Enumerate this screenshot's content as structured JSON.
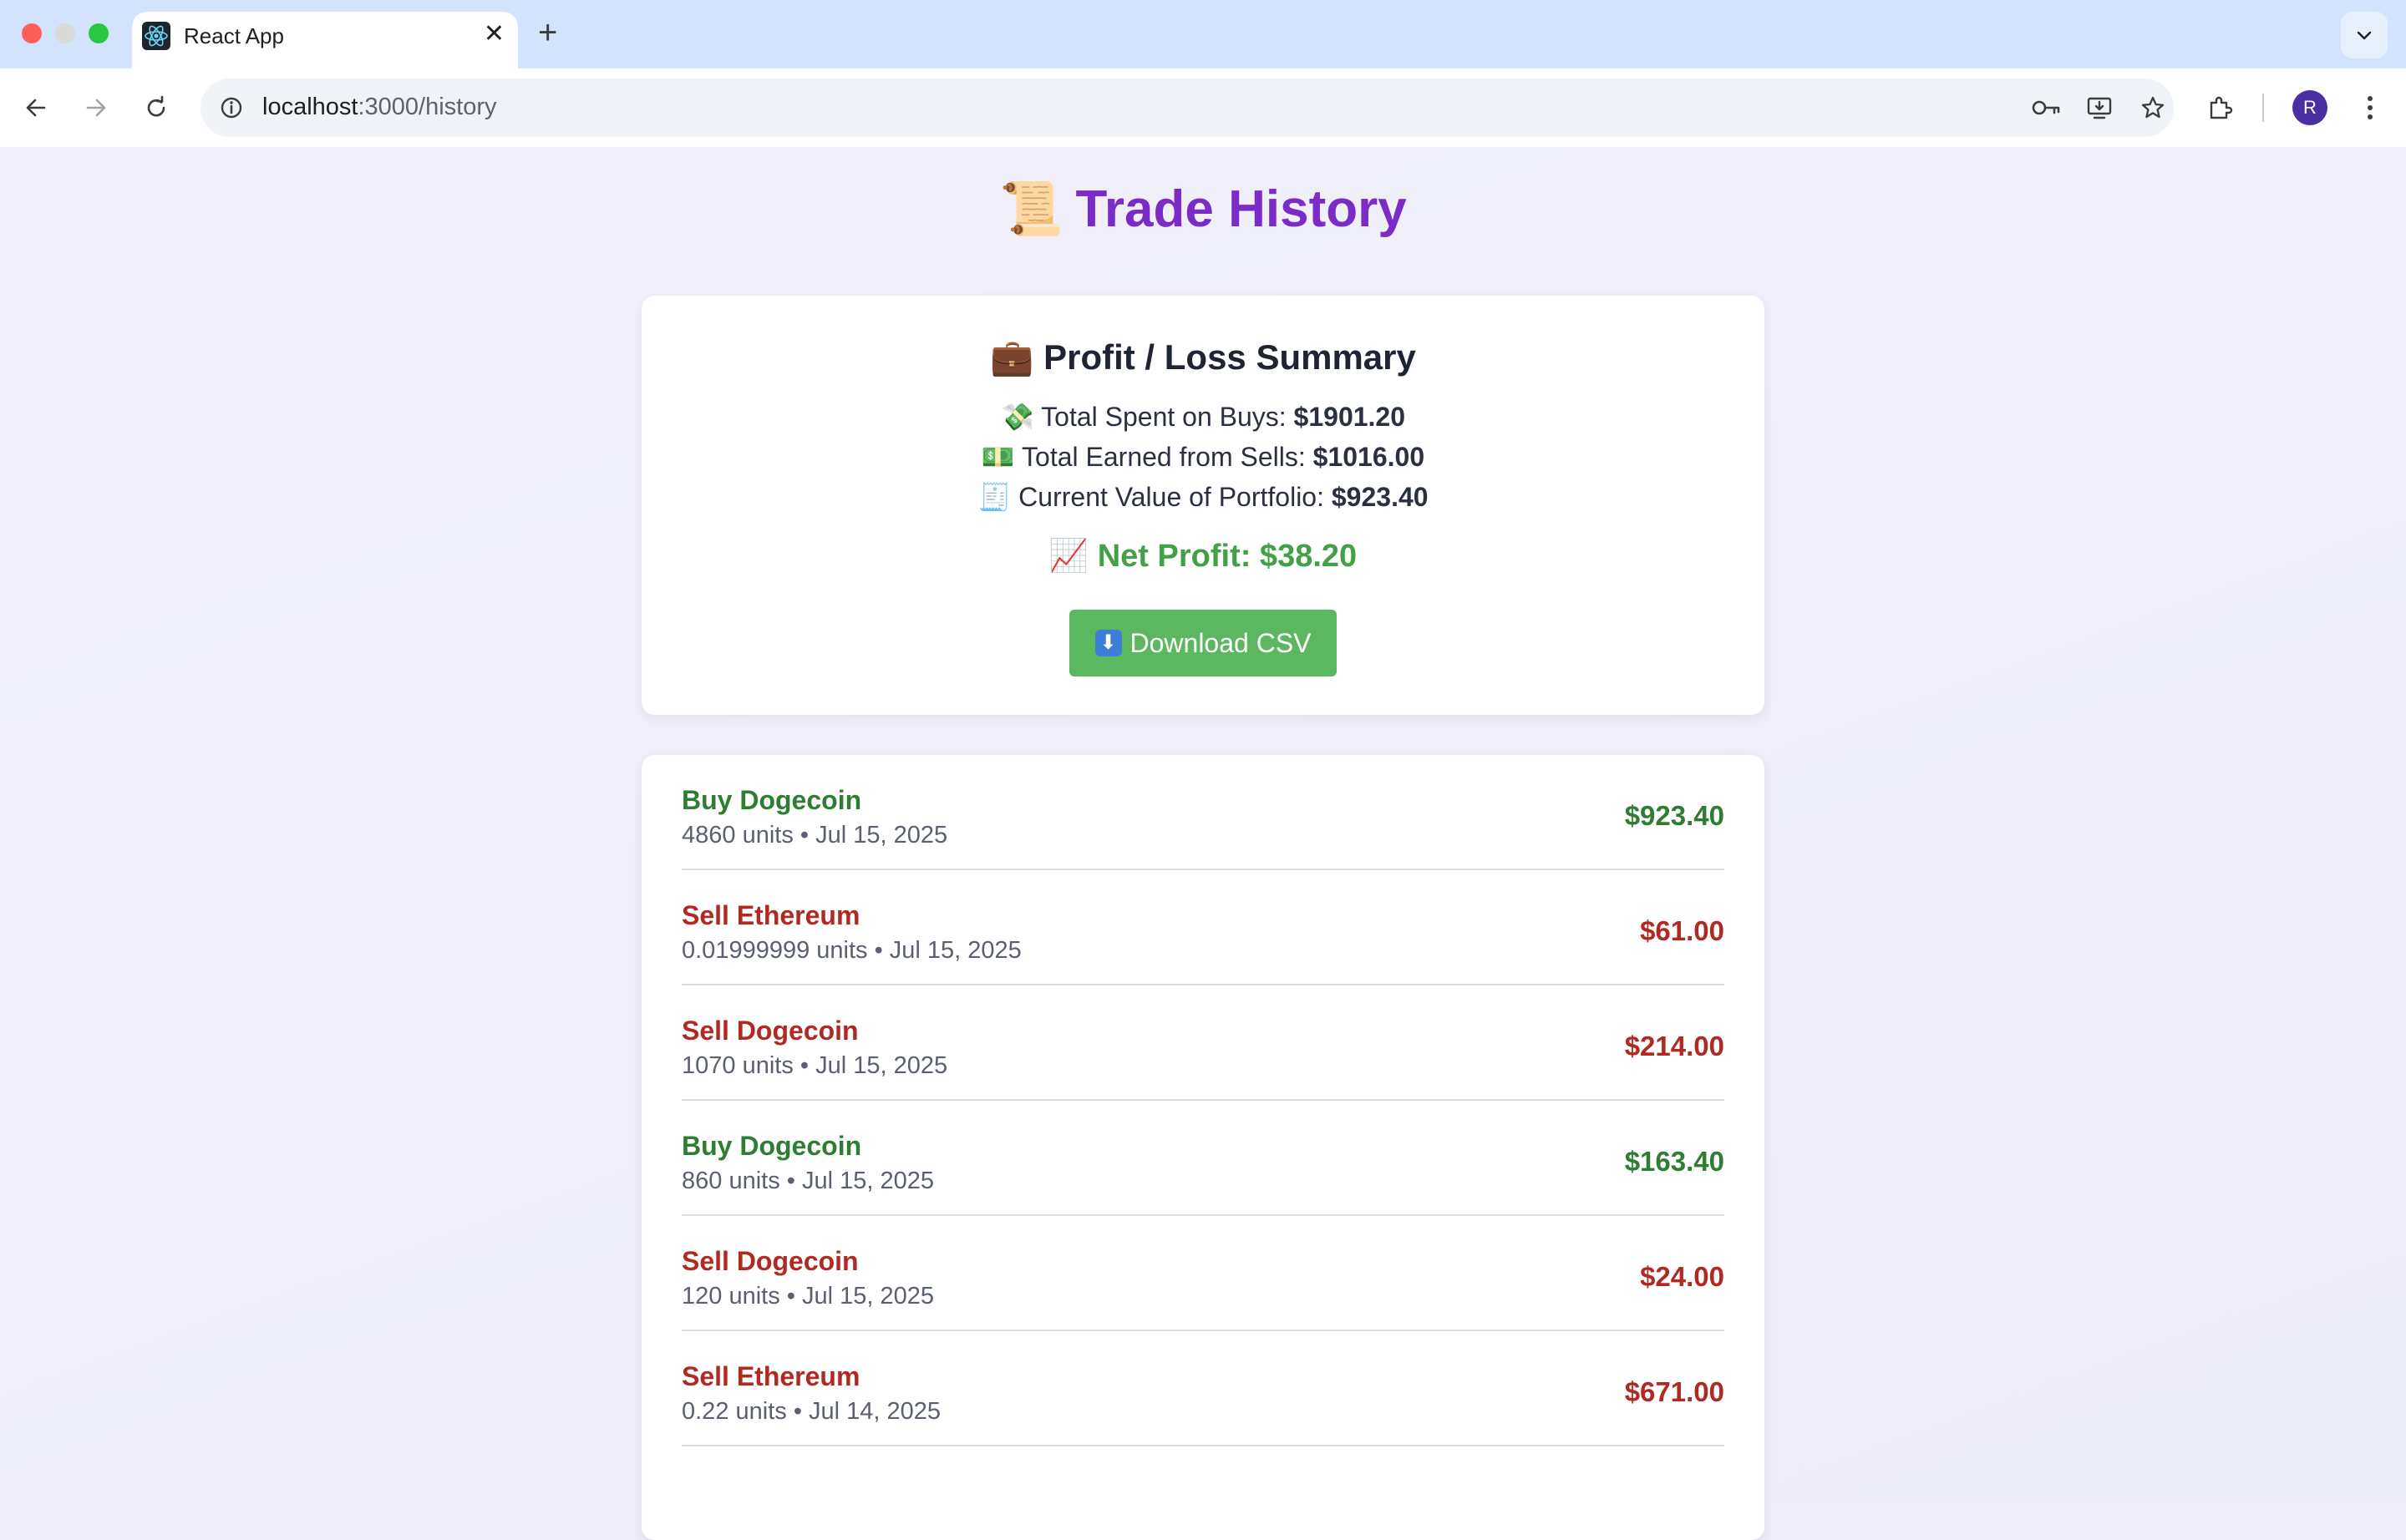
{
  "browser": {
    "tab_title": "React App",
    "url_host": "localhost",
    "url_path": ":3000/history",
    "avatar_letter": "R"
  },
  "page": {
    "title_emoji": "📜",
    "title": "Trade History"
  },
  "summary": {
    "title_emoji": "💼",
    "title": "Profit / Loss Summary",
    "spent_emoji": "💸",
    "spent_label": "Total Spent on Buys:",
    "spent_value": "$1901.20",
    "earned_emoji": "💵",
    "earned_label": "Total Earned from Sells:",
    "earned_value": "$1016.00",
    "portfolio_emoji": "🧾",
    "portfolio_label": "Current Value of Portfolio:",
    "portfolio_value": "$923.40",
    "net_emoji": "📈",
    "net_label": "Net Profit: $38.20",
    "download_label": "Download CSV"
  },
  "colors": {
    "buy": "#2e7d32",
    "sell": "#b02a22",
    "title": "#7b2bc7",
    "net_profit": "#43a047",
    "button": "#5cb860"
  },
  "trades": [
    {
      "type": "buy",
      "title": "Buy Dogecoin",
      "meta": "4860 units • Jul 15, 2025",
      "amount": "$923.40"
    },
    {
      "type": "sell",
      "title": "Sell Ethereum",
      "meta": "0.01999999 units • Jul 15, 2025",
      "amount": "$61.00"
    },
    {
      "type": "sell",
      "title": "Sell Dogecoin",
      "meta": "1070 units • Jul 15, 2025",
      "amount": "$214.00"
    },
    {
      "type": "buy",
      "title": "Buy Dogecoin",
      "meta": "860 units • Jul 15, 2025",
      "amount": "$163.40"
    },
    {
      "type": "sell",
      "title": "Sell Dogecoin",
      "meta": "120 units • Jul 15, 2025",
      "amount": "$24.00"
    },
    {
      "type": "sell",
      "title": "Sell Ethereum",
      "meta": "0.22 units • Jul 14, 2025",
      "amount": "$671.00"
    }
  ]
}
